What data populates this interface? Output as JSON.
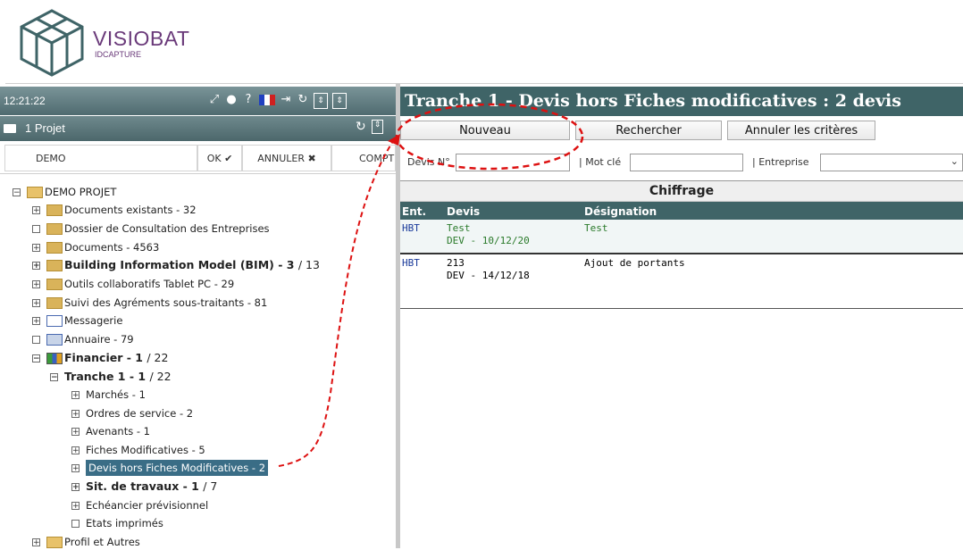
{
  "logo": {
    "name": "VISIOBAT",
    "sub": "IDCAPTURE"
  },
  "topbar": {
    "time": "12:21:22"
  },
  "project": {
    "title": "1 Projet"
  },
  "filter": {
    "value": "DEMO",
    "ok": "OK ✔",
    "cancel": "ANNULER ✖",
    "compt": "COMPT"
  },
  "tree": {
    "root": "DEMO PROJET",
    "items": [
      {
        "label": "Documents existants - 32"
      },
      {
        "label": "Dossier de Consultation des Entreprises"
      },
      {
        "label": "Documents - 4563"
      },
      {
        "label": "Building Information Model (BIM) - 3",
        "extra": "/ 13"
      },
      {
        "label": "Outils collaboratifs Tablet PC - 29"
      },
      {
        "label": "Suivi des Agréments sous-traitants - 81"
      },
      {
        "label": "Messagerie"
      },
      {
        "label": "Annuaire - 79"
      },
      {
        "label": "Financier - 1",
        "extra": "/ 22"
      },
      {
        "label": "Tranche 1 - 1",
        "extra": "/ 22"
      },
      {
        "label": "Marchés - 1"
      },
      {
        "label": "Ordres de service - 2"
      },
      {
        "label": "Avenants - 1"
      },
      {
        "label": "Fiches Modificatives - 5"
      },
      {
        "label": "Devis hors Fiches Modificatives - 2"
      },
      {
        "label": "Sit. de travaux - 1",
        "extra": "/ 7"
      },
      {
        "label": "Echéancier prévisionnel"
      },
      {
        "label": "Etats imprimés"
      },
      {
        "label": "Profil et Autres"
      }
    ]
  },
  "right": {
    "title": "Tranche 1 - Devis hors Fiches modificatives : 2 devis",
    "buttons": {
      "new": "Nouveau",
      "search": "Rechercher",
      "reset": "Annuler les critères"
    },
    "criteria": {
      "devis": "Devis N°",
      "keyword": "| Mot clé",
      "company": "| Entreprise"
    },
    "section": "Chiffrage",
    "columns": {
      "ent": "Ent.",
      "devis": "Devis",
      "designation": "Désignation"
    },
    "rows": [
      {
        "ent": "HBT",
        "devis": "Test",
        "devis2": "DEV - 10/12/20",
        "designation": "Test"
      },
      {
        "ent": "HBT",
        "devis": "213",
        "devis2": "DEV - 14/12/18",
        "designation": "Ajout de portants"
      }
    ]
  },
  "colors": {
    "header": "#3f6467",
    "selected": "#3a6d86",
    "annotation": "#d11"
  }
}
